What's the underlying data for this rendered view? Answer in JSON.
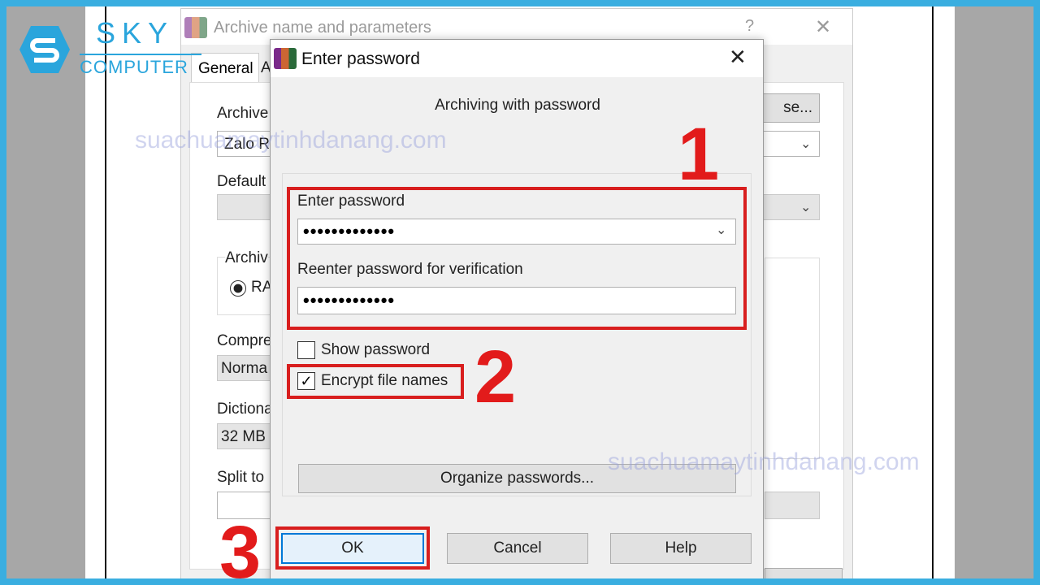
{
  "logo": {
    "brand": "SKY",
    "sub": "COMPUTER"
  },
  "watermark": "suachuamaytinhdanang.com",
  "colors": {
    "frame": "#3aaee0",
    "highlight": "#d81e1e",
    "accent": "#0078d7"
  },
  "background_dialog": {
    "title": "Archive name and parameters",
    "help": "?",
    "close": "✕",
    "tab_general": "General",
    "tab_next": "A",
    "archive_label": "Archive",
    "browse": "se...",
    "archive_value": "Zalo R",
    "default_label": "Default",
    "format_label": "Archiv",
    "format_rar": "RA",
    "compression_label": "Compre",
    "compression_value": "Norma",
    "dictionary_label": "Dictiona",
    "dictionary_value": "32 MB",
    "split_label": "Split to"
  },
  "dialog": {
    "title": "Enter password",
    "close": "✕",
    "subtitle": "Archiving with password",
    "enter_label": "Enter password",
    "enter_value": "•••••••••••••",
    "reenter_label": "Reenter password for verification",
    "reenter_value": "•••••••••••••",
    "show_password": {
      "label": "Show password",
      "checked": false
    },
    "encrypt_names": {
      "label": "Encrypt file names",
      "checked": true,
      "mark": "✓"
    },
    "organize": "Organize passwords...",
    "ok": "OK",
    "cancel": "Cancel",
    "help": "Help"
  },
  "steps": [
    "1",
    "2",
    "3"
  ]
}
